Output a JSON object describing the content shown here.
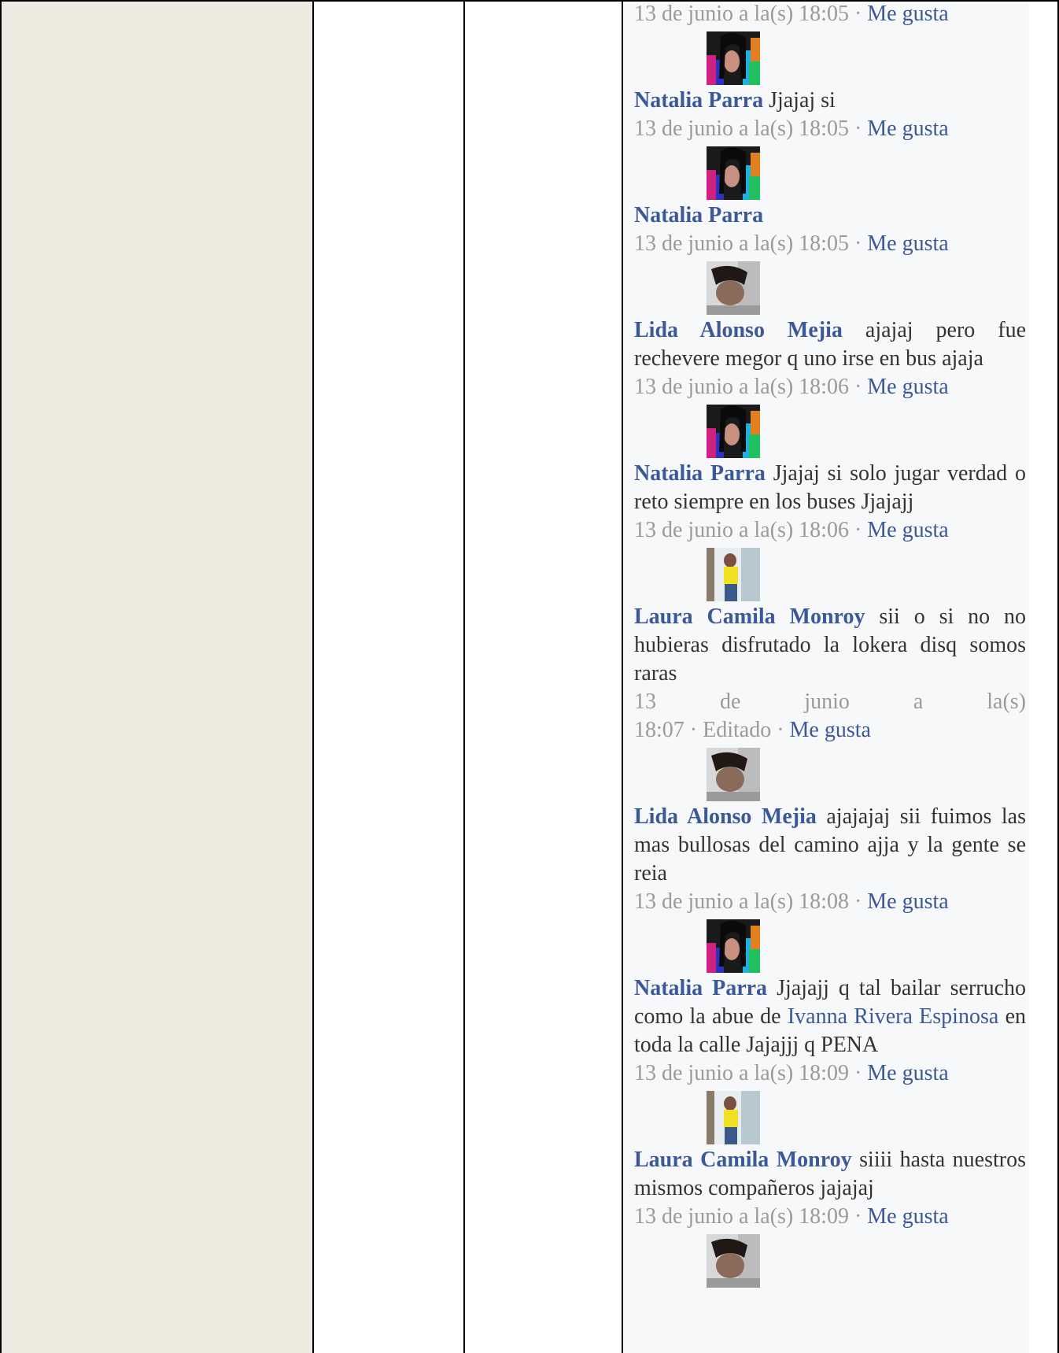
{
  "thread": {
    "first_meta": {
      "date": "13 de junio a la(s) 18:05",
      "sep": " · ",
      "like": "Me gusta"
    },
    "comments": [
      {
        "author": "Natalia Parra",
        "text": "Jjajaj si",
        "date": "13 de junio a la(s) 18:05",
        "sep": " · ",
        "like": "Me gusta",
        "avatar": "rainbow"
      },
      {
        "author": "Natalia Parra",
        "text": "",
        "date": "13 de junio a la(s) 18:05",
        "sep": " · ",
        "like": "Me gusta",
        "avatar": "rainbow"
      },
      {
        "author": "Lida Alonso Mejia",
        "text": "ajajaj pero fue rechevere megor q uno irse en bus ajaja",
        "date": "13 de junio a la(s) 18:06",
        "sep": " · ",
        "like": "Me gusta",
        "avatar": "face"
      },
      {
        "author": "Natalia Parra",
        "text": "Jjajaj si solo jugar verdad o reto siempre en los buses Jjajajj",
        "date": "13 de junio a la(s) 18:06",
        "sep": " · ",
        "like": "Me gusta",
        "avatar": "rainbow"
      },
      {
        "author": "Laura Camila Monroy",
        "text": "sii o si no no hubieras disfrutado la lokera disq somos raras",
        "date_line1": "13 de junio a la(s)",
        "date_line2": "18:07 · Editado · ",
        "like": "Me gusta",
        "avatar": "yellow"
      },
      {
        "author": "Lida Alonso Mejia",
        "text": "ajajajaj sii fuimos las mas bullosas del camino ajja y la gente se reia",
        "date": "13 de junio a la(s) 18:08",
        "sep": " · ",
        "like": "Me gusta",
        "avatar": "face"
      },
      {
        "author": "Natalia Parra",
        "text_before": "Jjajajj q tal bailar serrucho como la abue de ",
        "mention": "Ivanna Rivera Espinosa",
        "text_after": " en toda la calle Jajajjj q PENA",
        "date": "13 de junio a la(s) 18:09",
        "sep": " · ",
        "like": "Me gusta",
        "avatar": "rainbow"
      },
      {
        "author": "Laura Camila Monroy",
        "text": "siiii hasta nuestros mismos compañeros jajajaj",
        "date": "13 de junio a la(s) 18:09",
        "sep": " · ",
        "like": "Me gusta",
        "avatar": "yellow"
      }
    ],
    "last_avatar": "face"
  },
  "colors": {
    "link": "#3b5998",
    "meta": "#9a9a9a",
    "sidebar": "#edebe0"
  }
}
